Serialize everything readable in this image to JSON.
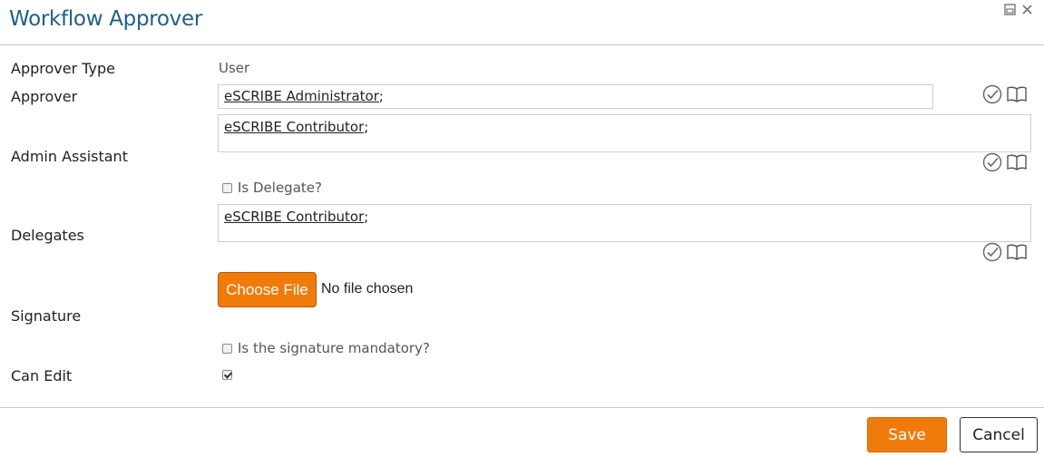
{
  "dialog": {
    "title": "Workflow Approver"
  },
  "window_icons": [
    "restore-icon",
    "close-icon"
  ],
  "form": {
    "approver_type": {
      "label": "Approver Type",
      "value": "User"
    },
    "approver": {
      "label": "Approver",
      "link": "eSCRIBE Administrator",
      "suffix": ";"
    },
    "admin_assistant": {
      "label": "Admin Assistant",
      "link": "eSCRIBE Contributor",
      "suffix": ";"
    },
    "is_delegate": {
      "label": "Is Delegate?",
      "checked": false
    },
    "delegates": {
      "label": "Delegates",
      "link": "eSCRIBE Contributor",
      "suffix": ";"
    },
    "signature": {
      "label": "Signature",
      "choose_file_label": "Choose File",
      "file_status": "No file chosen",
      "mandatory_label": "Is the signature mandatory?",
      "mandatory_checked": false
    },
    "can_edit": {
      "label": "Can Edit",
      "checked": true
    }
  },
  "footer": {
    "save_label": "Save",
    "cancel_label": "Cancel"
  },
  "colors": {
    "title": "#1f5f86",
    "accent": "#f07a0a",
    "divider": "#c9c9c9"
  }
}
